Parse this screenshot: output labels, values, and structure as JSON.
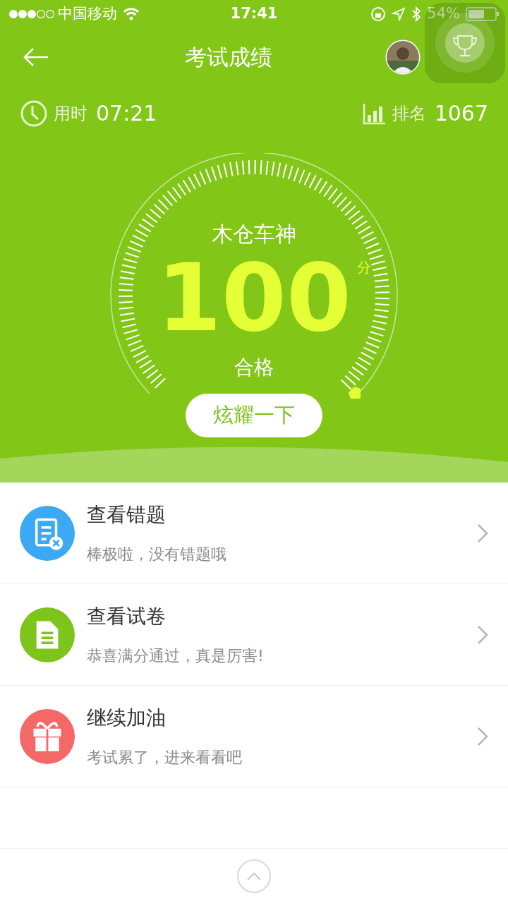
{
  "status_bar": {
    "carrier": "中国移动",
    "time": "17:41",
    "battery": "54%"
  },
  "header": {
    "title": "考试成绩"
  },
  "stats": {
    "time_label": "用时",
    "time_value": "07:21",
    "rank_label": "排名",
    "rank_value": "1067"
  },
  "gauge": {
    "title": "木仓车神",
    "score": "100",
    "unit": "分",
    "result": "合格"
  },
  "share_button": "炫耀一下",
  "items": [
    {
      "kind": "wrong",
      "color": "#3ca9f4",
      "title": "查看错题",
      "subtitle": "棒极啦，没有错题哦"
    },
    {
      "kind": "paper",
      "color": "#7dc41b",
      "title": "查看试卷",
      "subtitle": "恭喜满分通过，真是厉害!"
    },
    {
      "kind": "gift",
      "color": "#f56868",
      "title": "继续加油",
      "subtitle": "考试累了，进来看看吧"
    }
  ]
}
